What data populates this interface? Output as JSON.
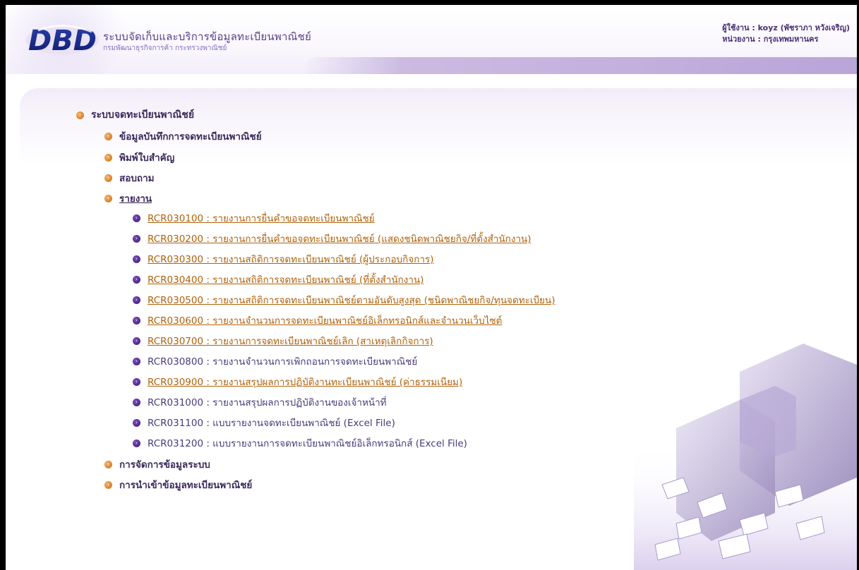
{
  "header": {
    "logo_text": "DBD",
    "system_title": "ระบบจัดเก็บและบริการข้อมูลทะเบียนพาณิชย์",
    "department": "กรมพัฒนาธุรกิจการค้า กระทรวงพาณิชย์",
    "user_line": "ผู้ใช้งาน : koyz (พัชราภา หวังเจริญ)",
    "unit_line": "หน่วยงาน : กรุงเทพมหานคร"
  },
  "menu": {
    "root": "ระบบจดทะเบียนพาณิชย์",
    "items": [
      "ข้อมูลบันทึกการจดทะเบียนพาณิชย์",
      "พิมพ์ใบสำคัญ",
      "สอบถาม",
      "รายงาน"
    ],
    "reports": [
      "RCR030100 : รายงานการยื่นคำขอจดทะเบียนพาณิชย์",
      "RCR030200 : รายงานการยื่นคำขอจดทะเบียนพาณิชย์ (แสดงชนิดพาณิชยกิจ/ที่ตั้งสำนักงาน)",
      "RCR030300 : รายงานสถิติการจดทะเบียนพาณิชย์ (ผู้ประกอบกิจการ)",
      "RCR030400 : รายงานสถิติการจดทะเบียนพาณิชย์ (ที่ตั้งสำนักงาน)",
      "RCR030500 : รายงานสถิติการจดทะเบียนพาณิชย์ตามอันดับสูงสุด (ชนิดพาณิชยกิจ/ทุนจดทะเบียน)",
      "RCR030600 : รายงานจำนวนการจดทะเบียนพาณิชย์อิเล็กทรอนิกส์และจำนวนเว็บไซต์",
      "RCR030700 : รายงานการจดทะเบียนพาณิชย์เลิก (สาเหตุเลิกกิจการ)",
      "RCR030800 : รายงานจำนวนการเพิกถอนการจดทะเบียนพาณิชย์",
      "RCR030900 : รายงานสรุปผลการปฏิบัติงานทะเบียนพาณิชย์ (ค่าธรรมเนียม)",
      "RCR031000 : รายงานสรุปผลการปฏิบัติงานของเจ้าหน้าที่",
      "RCR031100 : แบบรายงานจดทะเบียนพาณิชย์ (Excel File)",
      "RCR031200 : แบบรายงานการจดทะเบียนพาณิชย์อิเล็กทรอนิกส์ (Excel File)"
    ],
    "tail_items": [
      "การจัดการข้อมูลระบบ",
      "การนำเข้าข้อมูลทะเบียนพาณิชย์"
    ]
  },
  "icons": {
    "bullet": "circle-chevron-right-icon",
    "illustration": "documents-illustration"
  },
  "colors": {
    "brand_purple": "#5a3f8c",
    "link_orange": "#b0620c",
    "bullet_orange": "#e0892a",
    "bullet_purple": "#4a1f8a"
  }
}
